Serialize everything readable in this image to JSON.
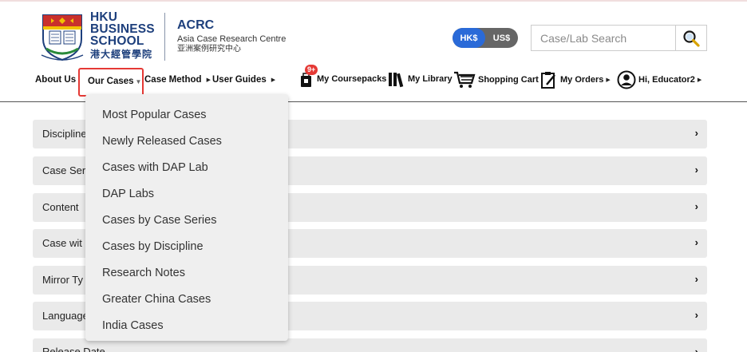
{
  "header": {
    "school_line1": "HKU",
    "school_line2": "BUSINESS",
    "school_line3": "SCHOOL",
    "school_cn": "港大經管學院",
    "centre_short": "ACRC",
    "centre_full": "Asia Case Research Centre",
    "centre_cn": "亚洲案例研究中心"
  },
  "currency": {
    "options": [
      "HK$",
      "US$"
    ],
    "selected": "HK$"
  },
  "search": {
    "placeholder": "Case/Lab Search"
  },
  "nav": {
    "about": "About Us",
    "our_cases": "Our Cases",
    "case_method": "Case Method",
    "user_guides": "User Guides"
  },
  "utility": {
    "coursepacks": "My Coursepacks",
    "coursepacks_badge": "9+",
    "library": "My Library",
    "cart": "Shopping Cart",
    "orders": "My Orders",
    "account": "Hi, Educator2"
  },
  "rows": [
    "Discipline",
    "Case Ser",
    "Content",
    "Case wit",
    "Mirror Ty",
    "Language",
    "Release Date"
  ],
  "dropdown": {
    "items": [
      "Most Popular Cases",
      "Newly Released Cases",
      "Cases with DAP Lab",
      "DAP Labs",
      "Cases by Case Series",
      "Cases by Discipline",
      "Research Notes",
      "Greater China Cases",
      "India Cases"
    ]
  },
  "colors": {
    "brand_blue": "#1d3f7c",
    "accent_blue": "#2a6ad8",
    "highlight_red": "#e53935"
  }
}
